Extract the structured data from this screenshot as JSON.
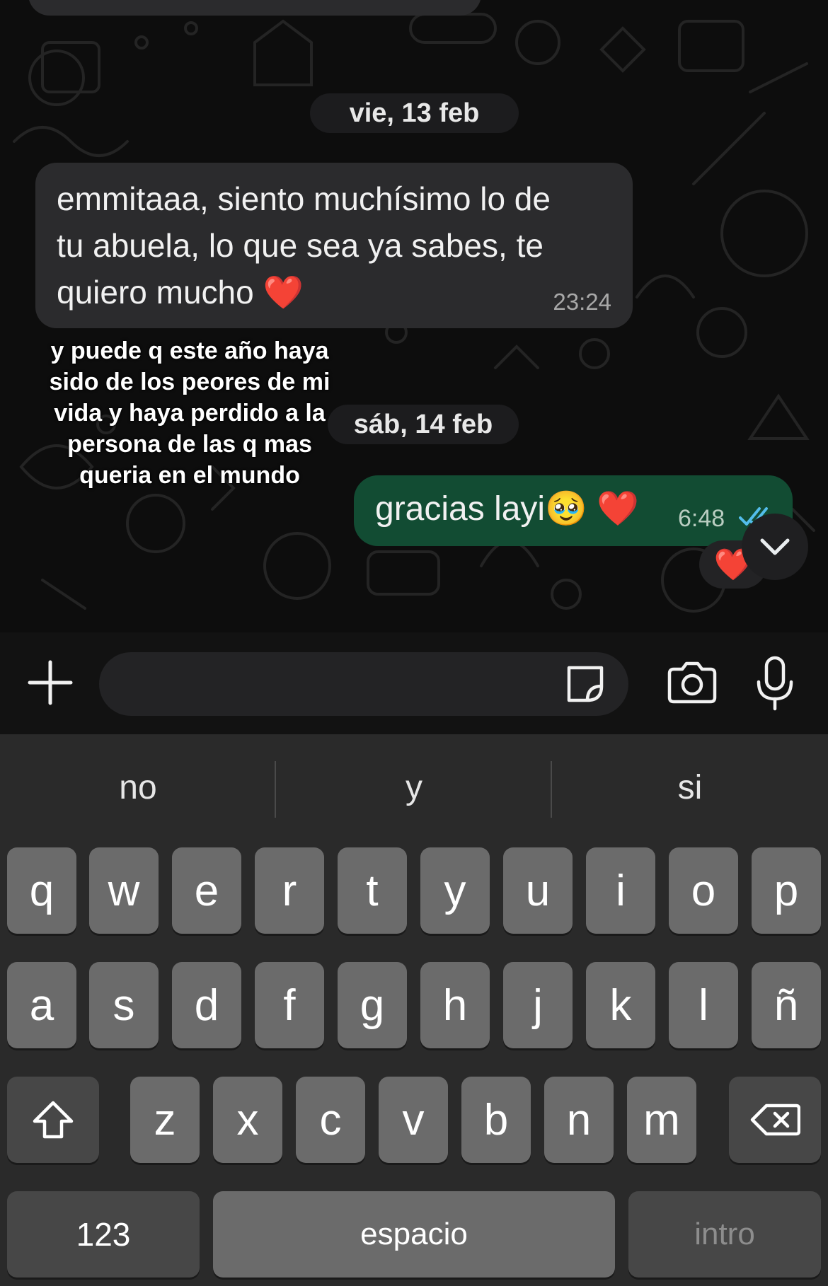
{
  "chat": {
    "date_1": "vie, 13 feb",
    "date_2": "sáb, 14 feb",
    "incoming": {
      "text_line_1": "emmitaaa, siento muchísimo lo de",
      "text_line_2": "tu abuela, lo que sea ya sabes, te",
      "text_line_3": "quiero mucho",
      "emoji": "❤️",
      "time": "23:24"
    },
    "overlay_caption": "y puede q este año haya sido de los peores de mi vida y haya perdido a la persona de las q mas queria en el mundo",
    "outgoing": {
      "text": "gracias layi",
      "emoji_1": "🥹",
      "emoji_2": "❤️",
      "time": "6:48",
      "status_icon": "double-check-icon"
    },
    "reaction_emoji": "❤️",
    "scroll_icon": "chevron-down-icon"
  },
  "colors": {
    "incoming_bubble": "#2b2b2d",
    "outgoing_bubble": "#124c33",
    "read_check": "#53bdeb",
    "keyboard_bg": "#2a2a2a",
    "key_bg": "#6b6b6b"
  },
  "keyboard": {
    "suggestions": [
      "no",
      "y",
      "si"
    ],
    "row1": [
      "q",
      "w",
      "e",
      "r",
      "t",
      "y",
      "u",
      "i",
      "o",
      "p"
    ],
    "row2": [
      "a",
      "s",
      "d",
      "f",
      "g",
      "h",
      "j",
      "k",
      "l",
      "ñ"
    ],
    "row3": [
      "z",
      "x",
      "c",
      "v",
      "b",
      "n",
      "m"
    ],
    "numbers_label": "123",
    "space_label": "espacio",
    "return_label": "intro"
  }
}
